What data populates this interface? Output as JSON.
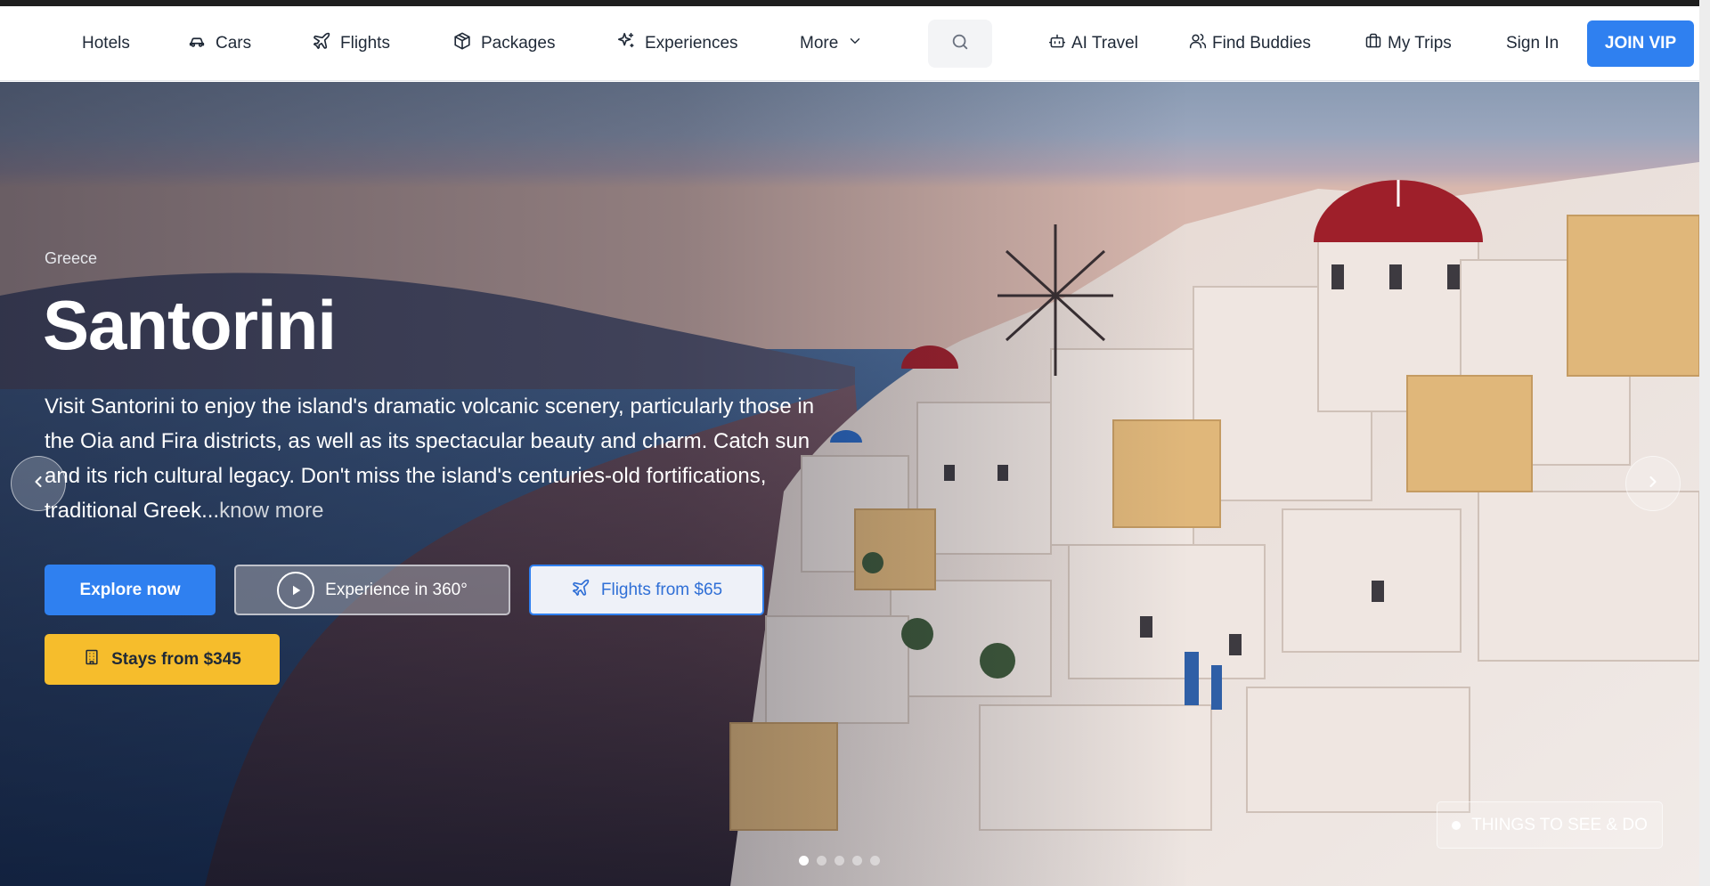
{
  "nav": {
    "items": [
      {
        "label": "Hotels",
        "icon": "none"
      },
      {
        "label": "Cars",
        "icon": "car-icon"
      },
      {
        "label": "Flights",
        "icon": "plane-icon"
      },
      {
        "label": "Packages",
        "icon": "package-icon"
      },
      {
        "label": "Experiences",
        "icon": "sparkles-icon"
      },
      {
        "label": "More",
        "icon": "chevron-down-icon"
      }
    ],
    "search_icon": "search-icon",
    "right_items": [
      {
        "label": "AI Travel",
        "icon": "bot-icon"
      },
      {
        "label": "Find Buddies",
        "icon": "users-icon"
      },
      {
        "label": "My Trips",
        "icon": "briefcase-icon"
      },
      {
        "label": "Sign In"
      }
    ],
    "join_label": "JOIN VIP"
  },
  "hero": {
    "country": "Greece",
    "title": "Santorini",
    "description": "Visit Santorini to enjoy the island's dramatic volcanic scenery, particularly those in the Oia and Fira districts, as well as its spectacular beauty and charm. Catch sun and its rich cultural legacy. Don't miss the island's centuries-old fortifications, traditional Greek...",
    "know_more": "know more",
    "buttons": {
      "explore": "Explore now",
      "experience": "Experience in 360°",
      "flights": "Flights from $65",
      "stays": "Stays from $345"
    },
    "things_label": "THINGS TO SEE & DO",
    "slide_count": 5,
    "active_slide": 1
  },
  "colors": {
    "primary": "#2f80f0",
    "accent_yellow": "#f6bd2c",
    "text_dark": "#1f2937"
  }
}
